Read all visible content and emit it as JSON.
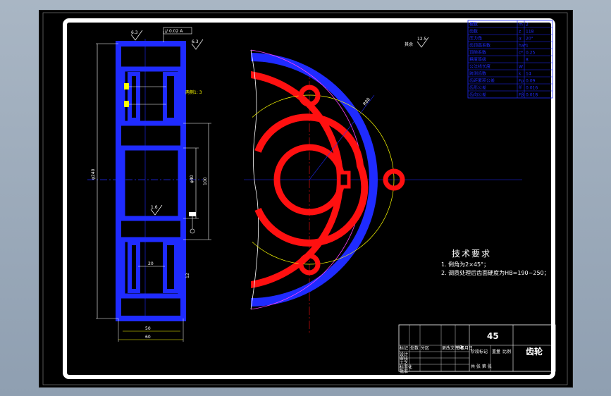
{
  "drawing": {
    "colors": {
      "background": "#000000",
      "frame": "#ffffff",
      "rim": "#1f2bff",
      "body": "#ff1010",
      "dimension": "#ffffff",
      "centerline": "#1f2bff",
      "pitch_circle": "#ffff00",
      "addendum_circle": "#ff40ff"
    },
    "surface_finish_label": "其余",
    "surface_finish_value": "12.5",
    "roughness_left_top": "6.3",
    "roughness_left_mid": "6.3",
    "roughness_left_lower": "1.6",
    "tolerance_frame": "// 0.02 A",
    "chamfer_note": "两侧1: 3",
    "dimension_labels": {
      "outer_diameter": "φ240",
      "bore": "φ40",
      "hub_width": "20",
      "face_width_bottom_1": "50",
      "face_width_bottom_2": "60",
      "web_thickness": "12",
      "hole_pitch": "100",
      "radius_label": "R88"
    }
  },
  "tech_requirements": {
    "title": "技术要求",
    "lines": [
      "1. 倒角为2×45°；",
      "2. 调质处理后齿面硬度为HB=190~250；"
    ]
  },
  "param_table": {
    "rows": [
      [
        "模数",
        "m",
        "2"
      ],
      [
        "齿数",
        "z",
        "118"
      ],
      [
        "压力角",
        "α",
        "20°"
      ],
      [
        "齿顶高系数",
        "ha*",
        "1"
      ],
      [
        "顶隙系数",
        "c*",
        "0.25"
      ],
      [
        "精度等级",
        "",
        "8"
      ],
      [
        "公法线长度",
        "W",
        ""
      ],
      [
        "跨测齿数",
        "k",
        "14"
      ],
      [
        "齿距累积公差",
        "Fp",
        "0.09"
      ],
      [
        "齿形公差",
        "ff",
        "0.016"
      ],
      [
        "齿向公差",
        "Fβ",
        "0.018"
      ]
    ]
  },
  "title_block": {
    "material": "45",
    "part_name": "齿轮",
    "headers": [
      "标记",
      "处数",
      "分区",
      "更改文件号",
      "签名",
      "年月日"
    ],
    "roles": [
      "设计",
      "审核",
      "工艺",
      "标准化",
      "批准"
    ],
    "stage_label": "阶段标记",
    "weight_label": "重量",
    "scale_label": "比例",
    "sheet_label": "共 张 第 张"
  }
}
